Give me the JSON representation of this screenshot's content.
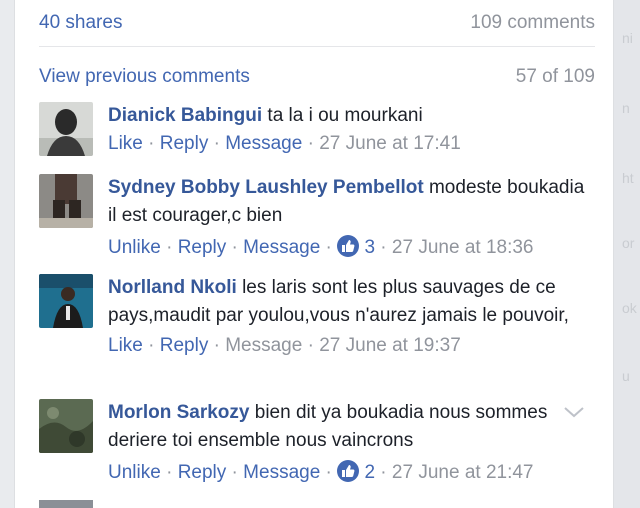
{
  "stats": {
    "shares": "40 shares",
    "comments": "109 comments"
  },
  "previous": {
    "label": "View previous comments",
    "position": "57 of 109"
  },
  "comments": [
    {
      "author": "Dianick Babingui",
      "text": "ta la i ou mourkani",
      "like_label": "Like",
      "reply_label": "Reply",
      "message_label": "Message",
      "time": "27 June at 17:41"
    },
    {
      "author": "Sydney Bobby Laushley Pembellot",
      "text": "modeste boukadia il est courager,c bien",
      "like_label": "Unlike",
      "reply_label": "Reply",
      "message_label": "Message",
      "likes": "3",
      "time": "27 June at 18:36"
    },
    {
      "author": "Norlland Nkoli",
      "text": "les laris sont les plus sauvages de ce pays,maudit par youlou,vous n'aurez jamais le pouvoir,",
      "like_label": "Like",
      "reply_label": "Reply",
      "message_label": "Message",
      "time": "27 June at 19:37"
    },
    {
      "author": "Morlon Sarkozy",
      "text": "bien dit ya boukadia nous sommes deriere toi ensemble nous vaincrons",
      "like_label": "Unlike",
      "reply_label": "Reply",
      "message_label": "Message",
      "likes": "2",
      "time": "27 June at 21:47"
    }
  ],
  "colors": {
    "link": "#4267b2",
    "author": "#365899",
    "muted": "#90949c",
    "text": "#1d2129"
  },
  "icons": {
    "like_badge": "thumbs-up-icon",
    "options": "chevron-down-icon"
  }
}
